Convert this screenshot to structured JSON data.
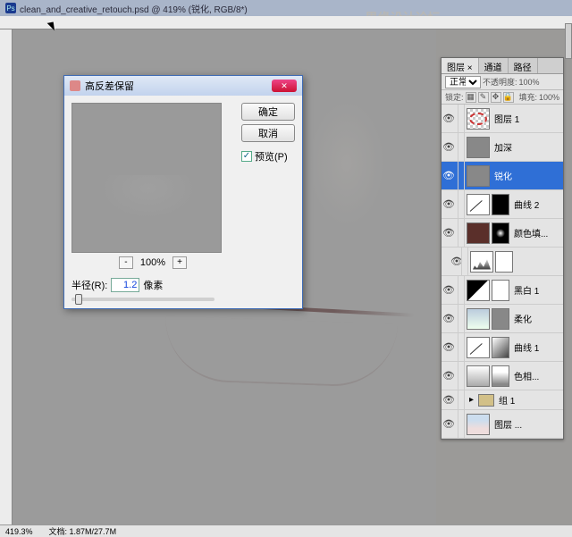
{
  "titlebar": {
    "filename": "clean_and_creative_retouch.psd @ 419% (锐化, RGB/8*)"
  },
  "watermark": {
    "site": "思缘设计论坛",
    "url": "WWW.MISSYUAN.COM"
  },
  "dialog": {
    "title": "高反差保留",
    "ok": "确定",
    "cancel": "取消",
    "preview_label": "预览(P)",
    "zoom": "100%",
    "zoom_out": "-",
    "zoom_in": "+",
    "radius_label": "半径(R):",
    "radius_value": "1.2",
    "radius_unit": "像素"
  },
  "layers_panel": {
    "tabs": [
      "图层 ×",
      "通道",
      "路径"
    ],
    "blend_mode": "正常",
    "opacity_label": "不透明度:",
    "opacity_value": "100%",
    "lock_label": "锁定:",
    "fill_label": "填充:",
    "fill_value": "100%",
    "layers": [
      {
        "name": "图层 1",
        "thumb": "checker",
        "mask": null
      },
      {
        "name": "加深",
        "thumb": "gray",
        "mask": null
      },
      {
        "name": "锐化",
        "thumb": "gray",
        "mask": null,
        "selected": true
      },
      {
        "name": "曲线 2",
        "thumb": "curves",
        "mask": "black"
      },
      {
        "name": "颜色填...",
        "thumb": "darkred",
        "mask": "black-circle"
      },
      {
        "name": "",
        "thumb": "histogram",
        "mask": "white",
        "indent": true
      },
      {
        "name": "黑白 1",
        "thumb": "bw",
        "mask": "white"
      },
      {
        "name": "柔化",
        "thumb": "photo",
        "mask": "grayface"
      },
      {
        "name": "曲线 1",
        "thumb": "curves",
        "mask": "gradient"
      },
      {
        "name": "色相...",
        "thumb": "grad",
        "mask": "smudge"
      },
      {
        "name": "组 1",
        "thumb": "folder",
        "mask": null,
        "group": true
      },
      {
        "name": "图层 ...",
        "thumb": "face",
        "mask": null
      }
    ]
  },
  "statusbar": {
    "zoom": "419.3%",
    "doc": "文档: 1.87M/27.7M"
  }
}
